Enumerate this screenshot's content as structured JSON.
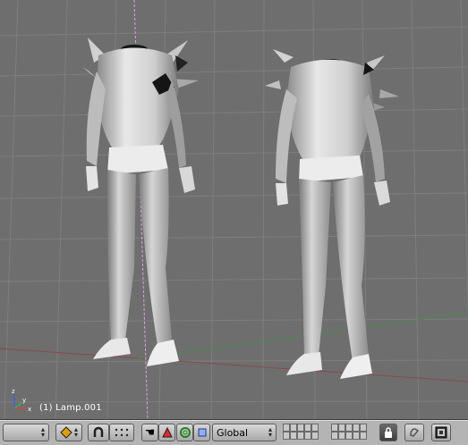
{
  "viewport": {
    "object_label": "(1) Lamp.001",
    "axis_labels": {
      "z": "z",
      "x": "x",
      "y": "y"
    }
  },
  "header": {
    "mode_select": {
      "value": ""
    },
    "transform_orientation": {
      "value": "Global"
    },
    "icons": {
      "draw_type": "solid-sphere-icon",
      "pivot": "magnet-icon",
      "snap": "snap-dots-icon",
      "manipulator_hand": "hand-icon",
      "manipulator_rotate": "triangle-icon",
      "manipulator_scale": "ring-icon",
      "manipulator_translate": "square-icon",
      "lock": "lock-icon",
      "render": "render-icon",
      "image": "image-icon"
    }
  },
  "colors": {
    "viewport_bg": "#6e6e6e",
    "grid": "#7c7c7c",
    "x_axis": "#8a4a4a",
    "y_axis": "#4a8a4a",
    "header_bg": "#b4b4b4",
    "cursor_line": "#e0a0e0"
  }
}
